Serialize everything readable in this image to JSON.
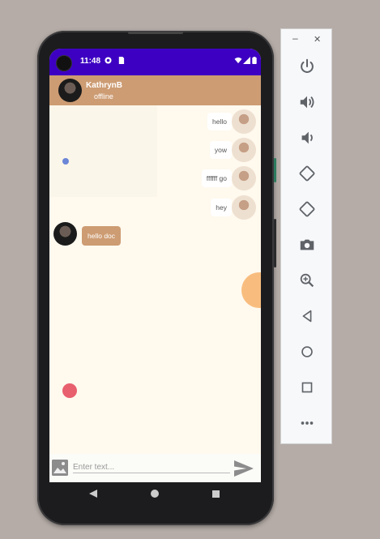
{
  "status_bar": {
    "time": "11:48"
  },
  "chat_header": {
    "contact_name": "KathrynB",
    "contact_status": "offline"
  },
  "messages": [
    {
      "direction": "out",
      "text": "hello"
    },
    {
      "direction": "out",
      "text": "yow"
    },
    {
      "direction": "out",
      "text": "ffffff go"
    },
    {
      "direction": "out",
      "text": "hey"
    },
    {
      "direction": "in",
      "text": "hello doc"
    }
  ],
  "composer": {
    "placeholder": "Enter text..."
  },
  "icons": {
    "gallery": "image-icon",
    "send": "send-icon",
    "nav_back": "back-triangle-icon",
    "nav_home": "home-circle-icon",
    "nav_recents": "recents-square-icon"
  },
  "emulator_panel": {
    "minimize_label": "–",
    "close_label": "✕",
    "tools": [
      "power-icon",
      "volume-up-icon",
      "volume-down-icon",
      "rotate-left-icon",
      "rotate-right-icon",
      "camera-icon",
      "zoom-icon",
      "back-icon",
      "home-icon",
      "overview-icon",
      "more-icon"
    ]
  },
  "colors": {
    "status_bar": "#3d00c2",
    "header": "#cd9c73",
    "chat_bg": "#fff9ee",
    "incoming_bubble": "#cd9c73",
    "outgoing_bubble": "#ffffff",
    "fab_orange": "#f8bd7e",
    "dot_red": "#e85f6e",
    "dot_blue": "#6b86d6"
  }
}
